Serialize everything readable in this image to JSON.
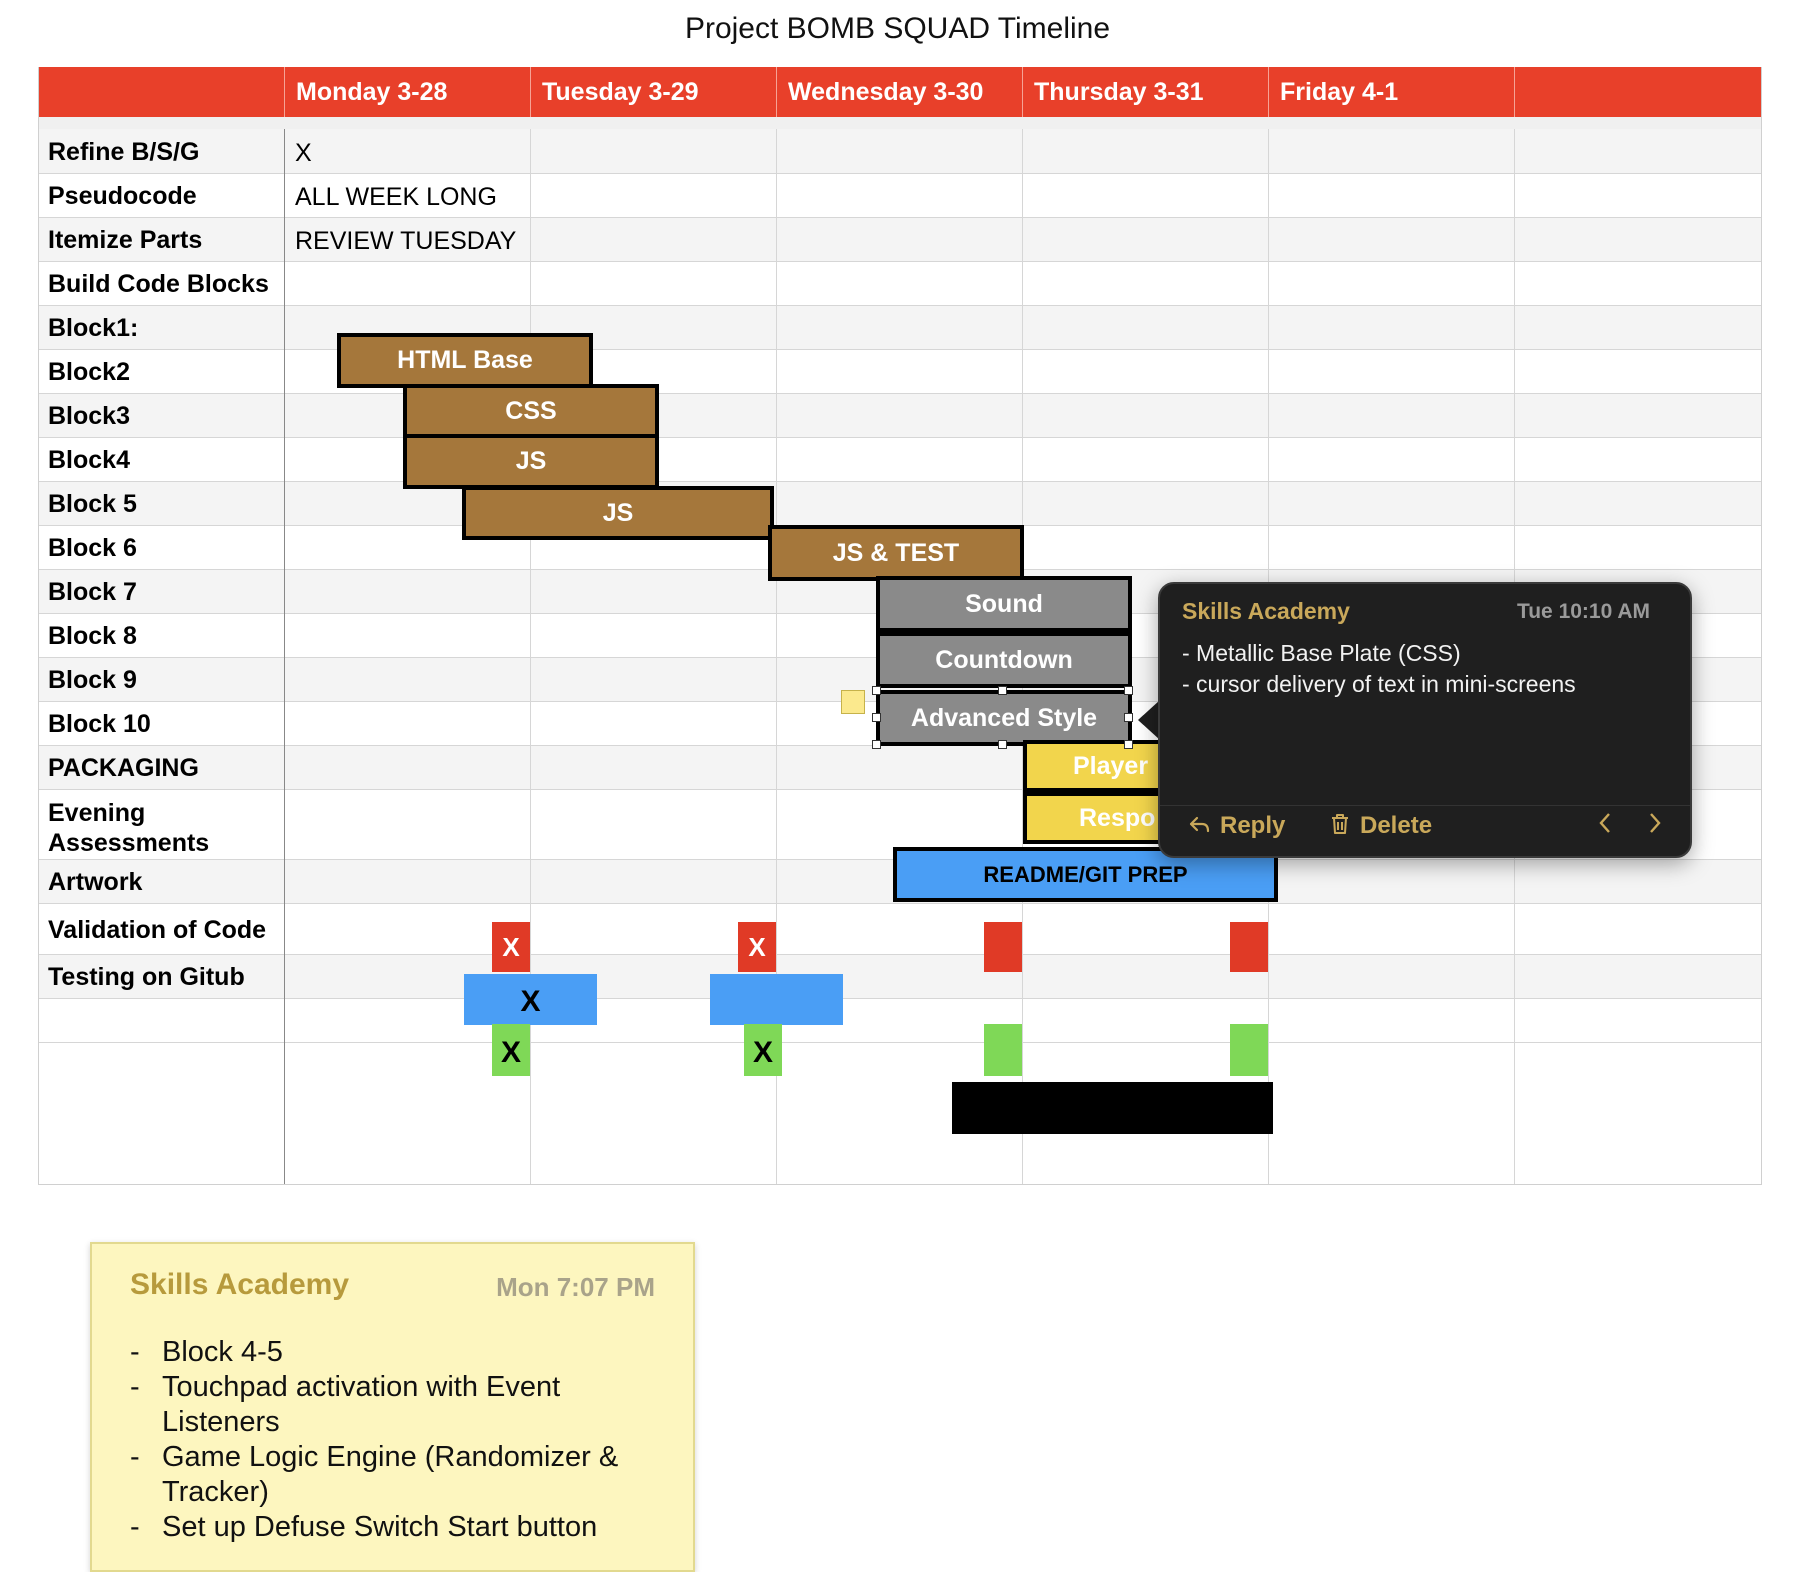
{
  "title": "Project BOMB SQUAD Timeline",
  "days": [
    "Monday 3-28",
    "Tuesday 3-29",
    "Wednesday 3-30",
    "Thursday 3-31",
    "Friday 4-1"
  ],
  "rows": [
    {
      "label": "Refine B/S/G",
      "value": "X"
    },
    {
      "label": "Pseudocode",
      "value": "ALL WEEK LONG"
    },
    {
      "label": "Itemize Parts",
      "value": "REVIEW TUESDAY"
    },
    {
      "label": "Build Code Blocks",
      "value": ""
    },
    {
      "label": "Block1:",
      "value": ""
    },
    {
      "label": "Block2",
      "value": ""
    },
    {
      "label": "Block3",
      "value": ""
    },
    {
      "label": "Block4",
      "value": ""
    },
    {
      "label": "Block 5",
      "value": ""
    },
    {
      "label": "Block 6",
      "value": ""
    },
    {
      "label": "Block 7",
      "value": ""
    },
    {
      "label": "Block 8",
      "value": ""
    },
    {
      "label": "Block 9",
      "value": ""
    },
    {
      "label": "Block 10",
      "value": ""
    },
    {
      "label": "PACKAGING",
      "value": ""
    },
    {
      "label": "Evening",
      "label2": "Assessments",
      "value": ""
    },
    {
      "label": "Artwork",
      "value": ""
    },
    {
      "label": "Validation of Code",
      "value": ""
    },
    {
      "label": "Testing on Gitub",
      "value": ""
    },
    {
      "label": "",
      "value": ""
    }
  ],
  "bars": {
    "html_base": "HTML Base",
    "css": "CSS",
    "js1": "JS",
    "js2": "JS",
    "js_test": "JS & TEST",
    "sound": "Sound",
    "countdown": "Countdown",
    "advanced_style": "Advanced Style",
    "player": "Player I",
    "response": "Respo",
    "readme": "README/GIT PREP"
  },
  "marks": {
    "assess_mon": "X",
    "assess_tue": "X",
    "artwork_mon": "X",
    "valid_mon": "X",
    "valid_tue": "X"
  },
  "colors": {
    "header": "#e8402a",
    "brown_block": "#a5773b",
    "gray_block": "#8a8a8a",
    "yellow_block": "#f2d54c",
    "blue_block": "#4a9ef5",
    "red_square": "#e03a26",
    "green_square": "#7fd857",
    "testing_bar": "#000000"
  },
  "comment_popup": {
    "author": "Skills Academy",
    "time": "Tue 10:10 AM",
    "lines": [
      "- Metallic Base Plate (CSS)",
      "- cursor delivery of text in mini-screens"
    ],
    "reply_label": "Reply",
    "delete_label": "Delete",
    "reply_icon": "reply-arrow-icon",
    "delete_icon": "trash-icon",
    "prev_icon": "chevron-left-icon",
    "next_icon": "chevron-right-icon"
  },
  "sticky_note": {
    "author": "Skills Academy",
    "time": "Mon 7:07 PM",
    "items": [
      [
        "Block 4-5"
      ],
      [
        "Touchpad activation with Event",
        "Listeners"
      ],
      [
        "Game Logic Engine (Randomizer &",
        "Tracker)"
      ],
      [
        "Set up Defuse Switch Start button"
      ]
    ]
  }
}
